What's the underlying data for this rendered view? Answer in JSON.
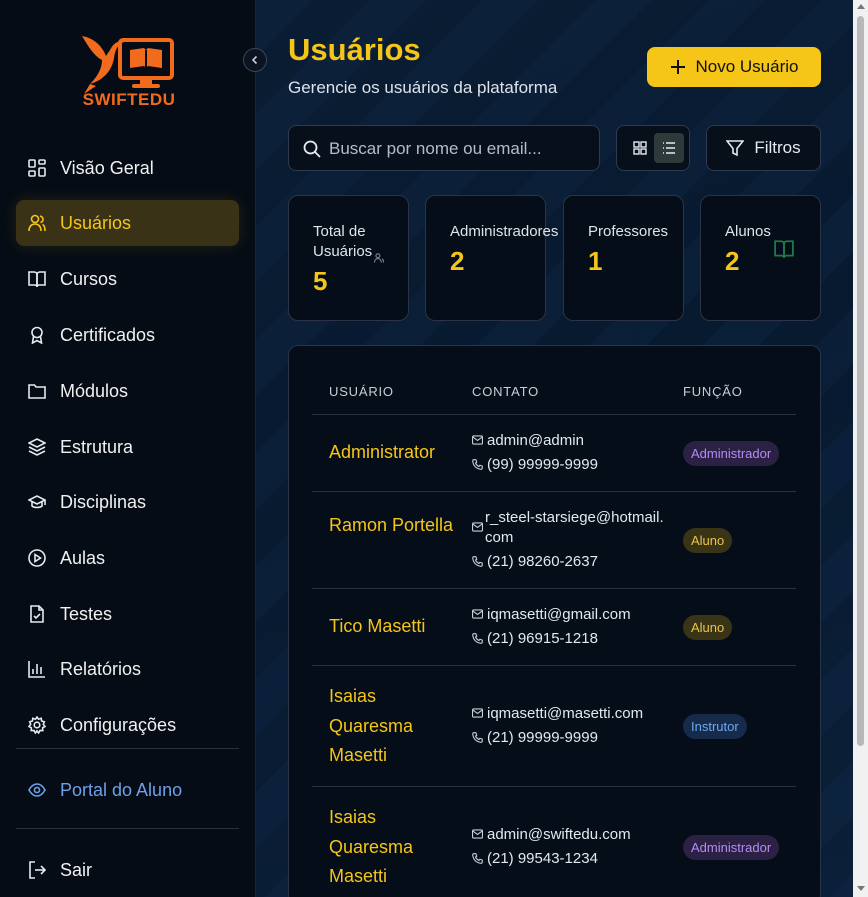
{
  "brand": {
    "name": "SWIFTEDU",
    "orange": "#f26a1b"
  },
  "colors": {
    "accent": "#f5c518",
    "sidebar_bg": "#050c15",
    "main_bg": "#0a1c33"
  },
  "sidebar": {
    "items": [
      {
        "label": "Visão Geral",
        "icon": "dashboard-icon"
      },
      {
        "label": "Usuários",
        "icon": "users-icon",
        "active": true
      },
      {
        "label": "Cursos",
        "icon": "book-open-icon"
      },
      {
        "label": "Certificados",
        "icon": "award-icon"
      },
      {
        "label": "Módulos",
        "icon": "folder-icon"
      },
      {
        "label": "Estrutura",
        "icon": "layers-icon"
      },
      {
        "label": "Disciplinas",
        "icon": "graduation-cap-icon"
      },
      {
        "label": "Aulas",
        "icon": "play-circle-icon"
      },
      {
        "label": "Testes",
        "icon": "file-check-icon"
      },
      {
        "label": "Relatórios",
        "icon": "bar-chart-icon"
      },
      {
        "label": "Configurações",
        "icon": "gear-icon"
      }
    ],
    "portal": {
      "label": "Portal do Aluno",
      "icon": "eye-icon"
    },
    "logout": {
      "label": "Sair",
      "icon": "logout-icon"
    }
  },
  "header": {
    "title": "Usuários",
    "subtitle": "Gerencie os usuários da plataforma",
    "new_button": "Novo Usuário"
  },
  "toolbar": {
    "search_placeholder": "Buscar por nome ou email...",
    "filters_label": "Filtros",
    "view_mode": "list"
  },
  "stats": [
    {
      "label_line1": "Total de",
      "label_line2": "Usuários",
      "value": "5",
      "icon": "users-icon"
    },
    {
      "label_line1": "Administradores",
      "label_line2": "",
      "value": "2"
    },
    {
      "label_line1": "Professores",
      "label_line2": "",
      "value": "1"
    },
    {
      "label_line1": "Alunos",
      "label_line2": "",
      "value": "2",
      "icon": "book-open-icon"
    }
  ],
  "table": {
    "headers": {
      "user": "USUÁRIO",
      "contact": "CONTATO",
      "role": "FUNÇÃO"
    },
    "rows": [
      {
        "name": "Administrator",
        "email": "admin@admin",
        "phone": "(99) 99999-9999",
        "role": "Administrador",
        "role_type": "admin"
      },
      {
        "name": "Ramon Portella",
        "email": "r_steel-starsiege@hotmail.com",
        "phone": "(21) 98260-2637",
        "role": "Aluno",
        "role_type": "aluno"
      },
      {
        "name": "Tico Masetti",
        "email": "iqmasetti@gmail.com",
        "phone": "(21) 96915-1218",
        "role": "Aluno",
        "role_type": "aluno"
      },
      {
        "name": "Isaias Quaresma Masetti",
        "email": "iqmasetti@masetti.com",
        "phone": "(21) 99999-9999",
        "role": "Instrutor",
        "role_type": "instrutor"
      },
      {
        "name": "Isaias Quaresma Masetti",
        "email": "admin@swiftedu.com",
        "phone": "(21) 99543-1234",
        "role": "Administrador",
        "role_type": "admin"
      }
    ]
  }
}
